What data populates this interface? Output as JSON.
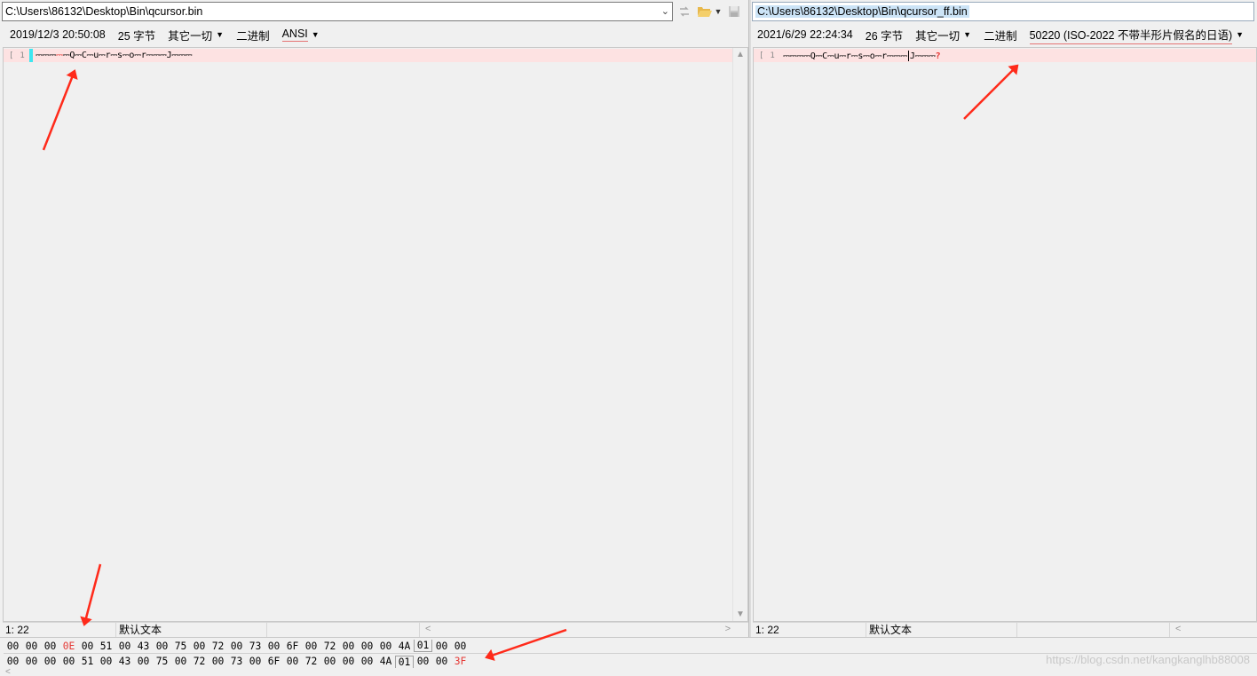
{
  "left": {
    "path": "C:\\Users\\86132\\Desktop\\Bin\\qcursor.bin",
    "date": "2019/12/3 20:50:08",
    "size": "25 字节",
    "filter": "其它一切",
    "mode": "二进制",
    "encoding": "ANSI",
    "line_number": "1",
    "text_pre": "⎓⎓⎓",
    "text_red": "⎓",
    "text_post": "⎓Q⎓C⎓u⎓r⎓s⎓o⎓r⎓⎓⎓J⎓⎓⎓",
    "status_pos": "1: 22",
    "status_type": "默认文本"
  },
  "right": {
    "path": "C:\\Users\\86132\\Desktop\\Bin\\qcursor_ff.bin",
    "date": "2021/6/29 22:24:34",
    "size": "26 字节",
    "filter": "其它一切",
    "mode": "二进制",
    "encoding": "50220 (ISO-2022 不带半形片假名的日语)",
    "line_number": "1",
    "text_pre": "⎓⎓⎓⎓Q⎓C⎓u⎓r⎓s⎓o⎓r⎓⎓⎓",
    "text_post": "J⎓⎓⎓",
    "text_q": "?",
    "status_pos": "1: 22",
    "status_type": "默认文本"
  },
  "hex": {
    "row1": [
      "00",
      "00",
      "00",
      "0E",
      "00",
      "51",
      "00",
      "43",
      "00",
      "75",
      "00",
      "72",
      "00",
      "73",
      "00",
      "6F",
      "00",
      "72",
      "00",
      "00",
      "00",
      "4A",
      "01",
      "00",
      "00"
    ],
    "row2": [
      "00",
      "00",
      "00",
      "00",
      "51",
      "00",
      "43",
      "00",
      "75",
      "00",
      "72",
      "00",
      "73",
      "00",
      "6F",
      "00",
      "72",
      "00",
      "00",
      "00",
      "4A",
      "01",
      "00",
      "00",
      "3F"
    ],
    "row1_red_index": 3,
    "row2_red_index": 24,
    "row1_boxed_index": 22,
    "row2_boxed_index": 21
  },
  "watermark": "https://blog.csdn.net/kangkanglhb88008",
  "colors": {
    "diff_line": "#fde2e2",
    "diff_text": "#e53935",
    "cursor": "#3ee6f0",
    "arrow": "#ff2a1a"
  },
  "icons": {
    "swap": "swap-icon",
    "open": "folder-open-icon",
    "save": "save-icon"
  }
}
